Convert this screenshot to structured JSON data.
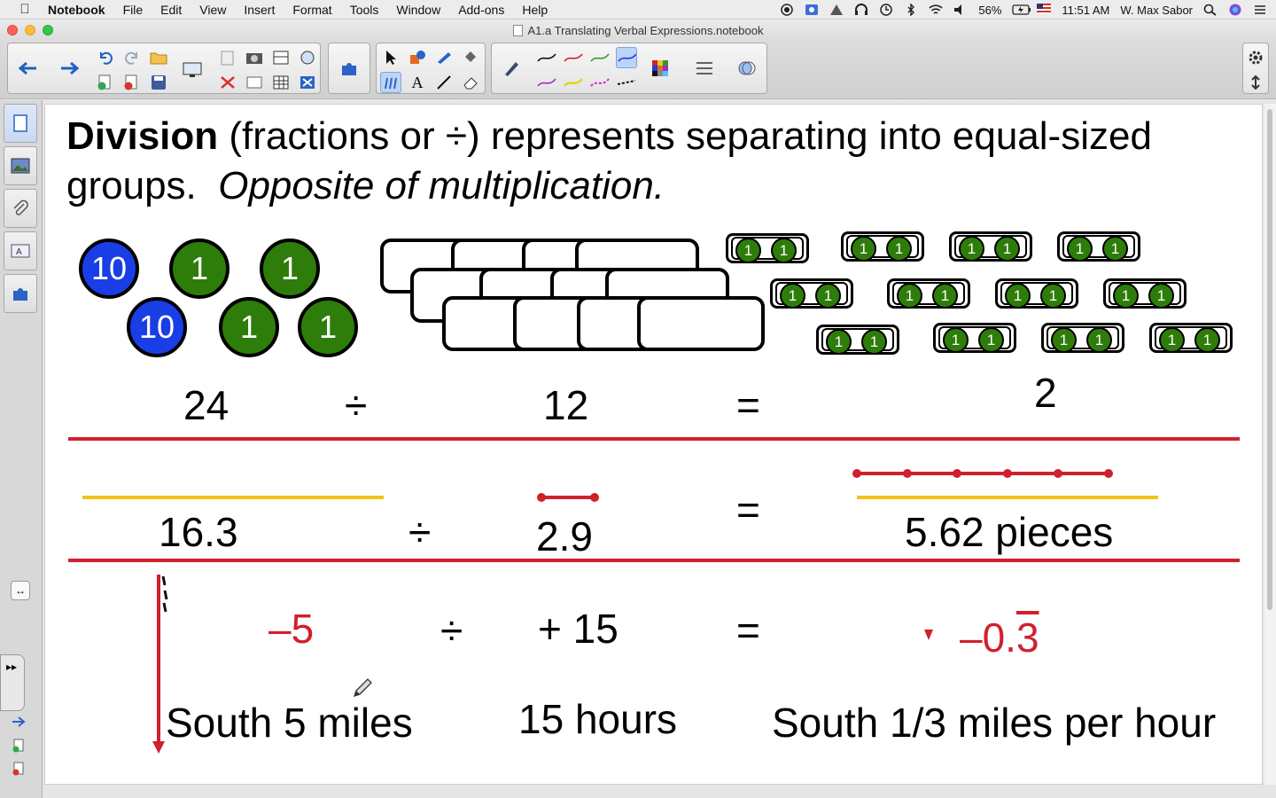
{
  "menubar": {
    "apple": "",
    "items": [
      "Notebook",
      "File",
      "Edit",
      "View",
      "Insert",
      "Format",
      "Tools",
      "Window",
      "Add-ons",
      "Help"
    ],
    "battery": "56%",
    "time": "11:51 AM",
    "user": "W. Max Sabor"
  },
  "window": {
    "title": "A1.a Translating Verbal Expressions.notebook"
  },
  "slide": {
    "heading_bold": "Division",
    "heading_rest": " (fractions or ÷) represents separating into equal-sized groups.",
    "heading_italic": "Opposite of multiplication.",
    "coins": {
      "tens": [
        "10",
        "10"
      ],
      "ones": [
        "1",
        "1",
        "1",
        "1"
      ]
    },
    "pair_value": "1",
    "row1": {
      "dividend": "24",
      "op": "÷",
      "divisor": "12",
      "eq": "=",
      "quotient": "2"
    },
    "row2": {
      "dividend": "16.3",
      "op": "÷",
      "divisor": "2.9",
      "eq": "=",
      "quotient": "5.62 pieces"
    },
    "row3": {
      "dividend": "–5",
      "op": "÷",
      "divisor": "+ 15",
      "eq": "=",
      "quotient_prefix": "–0.",
      "quotient_repeat": "3",
      "label_dividend": "South 5 miles",
      "label_divisor": "15 hours",
      "label_quotient": "South 1/3 miles per hour"
    }
  },
  "colors": {
    "accent_red": "#d0202e",
    "coin_blue": "#1a3ee6",
    "coin_green": "#2e7d0a",
    "highlight_yellow": "#f0c419"
  }
}
